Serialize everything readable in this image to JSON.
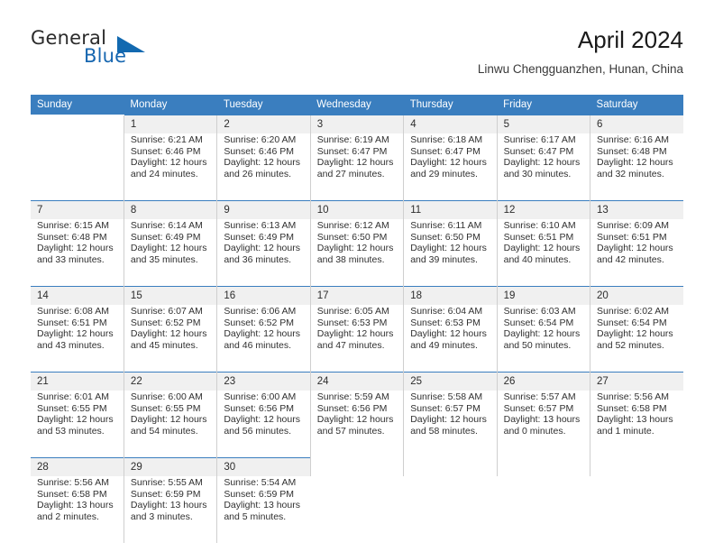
{
  "brand": {
    "word_one": "General",
    "word_two": "Blue",
    "triangle_icon": "triangle-logo-icon"
  },
  "header": {
    "title": "April 2024",
    "subtitle": "Linwu Chengguanzhen, Hunan, China"
  },
  "colors": {
    "header_blue": "#3a7ebf",
    "brand_blue": "#1269b0",
    "daynum_bg": "#f0f0f0",
    "cell_border": "#cfcfcf"
  },
  "weekdays": [
    "Sunday",
    "Monday",
    "Tuesday",
    "Wednesday",
    "Thursday",
    "Friday",
    "Saturday"
  ],
  "weeks": [
    [
      {
        "day": "",
        "sunrise": "",
        "sunset": "",
        "daylight1": "",
        "daylight2": "",
        "empty": true
      },
      {
        "day": "1",
        "sunrise": "Sunrise: 6:21 AM",
        "sunset": "Sunset: 6:46 PM",
        "daylight1": "Daylight: 12 hours",
        "daylight2": "and 24 minutes."
      },
      {
        "day": "2",
        "sunrise": "Sunrise: 6:20 AM",
        "sunset": "Sunset: 6:46 PM",
        "daylight1": "Daylight: 12 hours",
        "daylight2": "and 26 minutes."
      },
      {
        "day": "3",
        "sunrise": "Sunrise: 6:19 AM",
        "sunset": "Sunset: 6:47 PM",
        "daylight1": "Daylight: 12 hours",
        "daylight2": "and 27 minutes."
      },
      {
        "day": "4",
        "sunrise": "Sunrise: 6:18 AM",
        "sunset": "Sunset: 6:47 PM",
        "daylight1": "Daylight: 12 hours",
        "daylight2": "and 29 minutes."
      },
      {
        "day": "5",
        "sunrise": "Sunrise: 6:17 AM",
        "sunset": "Sunset: 6:47 PM",
        "daylight1": "Daylight: 12 hours",
        "daylight2": "and 30 minutes."
      },
      {
        "day": "6",
        "sunrise": "Sunrise: 6:16 AM",
        "sunset": "Sunset: 6:48 PM",
        "daylight1": "Daylight: 12 hours",
        "daylight2": "and 32 minutes."
      }
    ],
    [
      {
        "day": "7",
        "sunrise": "Sunrise: 6:15 AM",
        "sunset": "Sunset: 6:48 PM",
        "daylight1": "Daylight: 12 hours",
        "daylight2": "and 33 minutes."
      },
      {
        "day": "8",
        "sunrise": "Sunrise: 6:14 AM",
        "sunset": "Sunset: 6:49 PM",
        "daylight1": "Daylight: 12 hours",
        "daylight2": "and 35 minutes."
      },
      {
        "day": "9",
        "sunrise": "Sunrise: 6:13 AM",
        "sunset": "Sunset: 6:49 PM",
        "daylight1": "Daylight: 12 hours",
        "daylight2": "and 36 minutes."
      },
      {
        "day": "10",
        "sunrise": "Sunrise: 6:12 AM",
        "sunset": "Sunset: 6:50 PM",
        "daylight1": "Daylight: 12 hours",
        "daylight2": "and 38 minutes."
      },
      {
        "day": "11",
        "sunrise": "Sunrise: 6:11 AM",
        "sunset": "Sunset: 6:50 PM",
        "daylight1": "Daylight: 12 hours",
        "daylight2": "and 39 minutes."
      },
      {
        "day": "12",
        "sunrise": "Sunrise: 6:10 AM",
        "sunset": "Sunset: 6:51 PM",
        "daylight1": "Daylight: 12 hours",
        "daylight2": "and 40 minutes."
      },
      {
        "day": "13",
        "sunrise": "Sunrise: 6:09 AM",
        "sunset": "Sunset: 6:51 PM",
        "daylight1": "Daylight: 12 hours",
        "daylight2": "and 42 minutes."
      }
    ],
    [
      {
        "day": "14",
        "sunrise": "Sunrise: 6:08 AM",
        "sunset": "Sunset: 6:51 PM",
        "daylight1": "Daylight: 12 hours",
        "daylight2": "and 43 minutes."
      },
      {
        "day": "15",
        "sunrise": "Sunrise: 6:07 AM",
        "sunset": "Sunset: 6:52 PM",
        "daylight1": "Daylight: 12 hours",
        "daylight2": "and 45 minutes."
      },
      {
        "day": "16",
        "sunrise": "Sunrise: 6:06 AM",
        "sunset": "Sunset: 6:52 PM",
        "daylight1": "Daylight: 12 hours",
        "daylight2": "and 46 minutes."
      },
      {
        "day": "17",
        "sunrise": "Sunrise: 6:05 AM",
        "sunset": "Sunset: 6:53 PM",
        "daylight1": "Daylight: 12 hours",
        "daylight2": "and 47 minutes."
      },
      {
        "day": "18",
        "sunrise": "Sunrise: 6:04 AM",
        "sunset": "Sunset: 6:53 PM",
        "daylight1": "Daylight: 12 hours",
        "daylight2": "and 49 minutes."
      },
      {
        "day": "19",
        "sunrise": "Sunrise: 6:03 AM",
        "sunset": "Sunset: 6:54 PM",
        "daylight1": "Daylight: 12 hours",
        "daylight2": "and 50 minutes."
      },
      {
        "day": "20",
        "sunrise": "Sunrise: 6:02 AM",
        "sunset": "Sunset: 6:54 PM",
        "daylight1": "Daylight: 12 hours",
        "daylight2": "and 52 minutes."
      }
    ],
    [
      {
        "day": "21",
        "sunrise": "Sunrise: 6:01 AM",
        "sunset": "Sunset: 6:55 PM",
        "daylight1": "Daylight: 12 hours",
        "daylight2": "and 53 minutes."
      },
      {
        "day": "22",
        "sunrise": "Sunrise: 6:00 AM",
        "sunset": "Sunset: 6:55 PM",
        "daylight1": "Daylight: 12 hours",
        "daylight2": "and 54 minutes."
      },
      {
        "day": "23",
        "sunrise": "Sunrise: 6:00 AM",
        "sunset": "Sunset: 6:56 PM",
        "daylight1": "Daylight: 12 hours",
        "daylight2": "and 56 minutes."
      },
      {
        "day": "24",
        "sunrise": "Sunrise: 5:59 AM",
        "sunset": "Sunset: 6:56 PM",
        "daylight1": "Daylight: 12 hours",
        "daylight2": "and 57 minutes."
      },
      {
        "day": "25",
        "sunrise": "Sunrise: 5:58 AM",
        "sunset": "Sunset: 6:57 PM",
        "daylight1": "Daylight: 12 hours",
        "daylight2": "and 58 minutes."
      },
      {
        "day": "26",
        "sunrise": "Sunrise: 5:57 AM",
        "sunset": "Sunset: 6:57 PM",
        "daylight1": "Daylight: 13 hours",
        "daylight2": "and 0 minutes."
      },
      {
        "day": "27",
        "sunrise": "Sunrise: 5:56 AM",
        "sunset": "Sunset: 6:58 PM",
        "daylight1": "Daylight: 13 hours",
        "daylight2": "and 1 minute."
      }
    ],
    [
      {
        "day": "28",
        "sunrise": "Sunrise: 5:56 AM",
        "sunset": "Sunset: 6:58 PM",
        "daylight1": "Daylight: 13 hours",
        "daylight2": "and 2 minutes."
      },
      {
        "day": "29",
        "sunrise": "Sunrise: 5:55 AM",
        "sunset": "Sunset: 6:59 PM",
        "daylight1": "Daylight: 13 hours",
        "daylight2": "and 3 minutes."
      },
      {
        "day": "30",
        "sunrise": "Sunrise: 5:54 AM",
        "sunset": "Sunset: 6:59 PM",
        "daylight1": "Daylight: 13 hours",
        "daylight2": "and 5 minutes."
      },
      {
        "day": "",
        "sunrise": "",
        "sunset": "",
        "daylight1": "",
        "daylight2": "",
        "empty": true
      },
      {
        "day": "",
        "sunrise": "",
        "sunset": "",
        "daylight1": "",
        "daylight2": "",
        "empty": true
      },
      {
        "day": "",
        "sunrise": "",
        "sunset": "",
        "daylight1": "",
        "daylight2": "",
        "empty": true
      },
      {
        "day": "",
        "sunrise": "",
        "sunset": "",
        "daylight1": "",
        "daylight2": "",
        "empty": true
      }
    ]
  ]
}
